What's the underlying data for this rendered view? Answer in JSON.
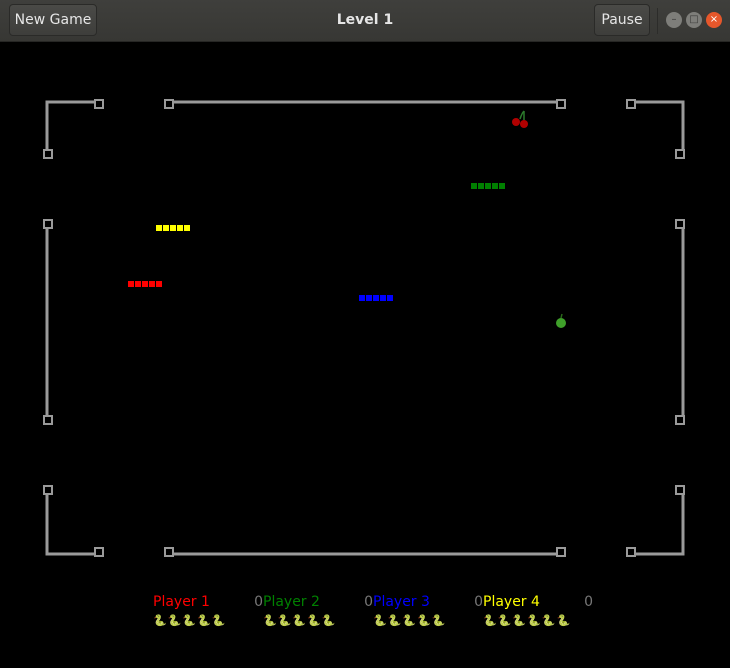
{
  "window": {
    "title": "Level 1",
    "new_game_label": "New Game",
    "pause_label": "Pause",
    "minimize_glyph": "–",
    "maximize_glyph": "□",
    "close_glyph": "×"
  },
  "colors": {
    "background": "#000000",
    "wall": "#9a9a9a",
    "player1": "#ff0000",
    "player2": "#008000",
    "player3": "#0000ff",
    "player4": "#ffff00",
    "score": "#777777"
  },
  "board_items": {
    "fruits": [
      {
        "type": "cherry",
        "icon": "cherry-icon"
      },
      {
        "type": "apple",
        "icon": "apple-icon"
      }
    ]
  },
  "players": [
    {
      "name": "Player 1",
      "score": "0",
      "lives": 5,
      "lives_icons": "🐍🐍🐍🐍🐍",
      "color": "#ff0000"
    },
    {
      "name": "Player 2",
      "score": "0",
      "lives": 5,
      "lives_icons": "🐍🐍🐍🐍🐍",
      "color": "#008000"
    },
    {
      "name": "Player 3",
      "score": "0",
      "lives": 5,
      "lives_icons": "🐍🐍🐍🐍🐍",
      "color": "#0000ff"
    },
    {
      "name": "Player 4",
      "score": "0",
      "lives": 6,
      "lives_icons": "🐍🐍🐍🐍🐍🐍",
      "color": "#ffff00"
    }
  ]
}
